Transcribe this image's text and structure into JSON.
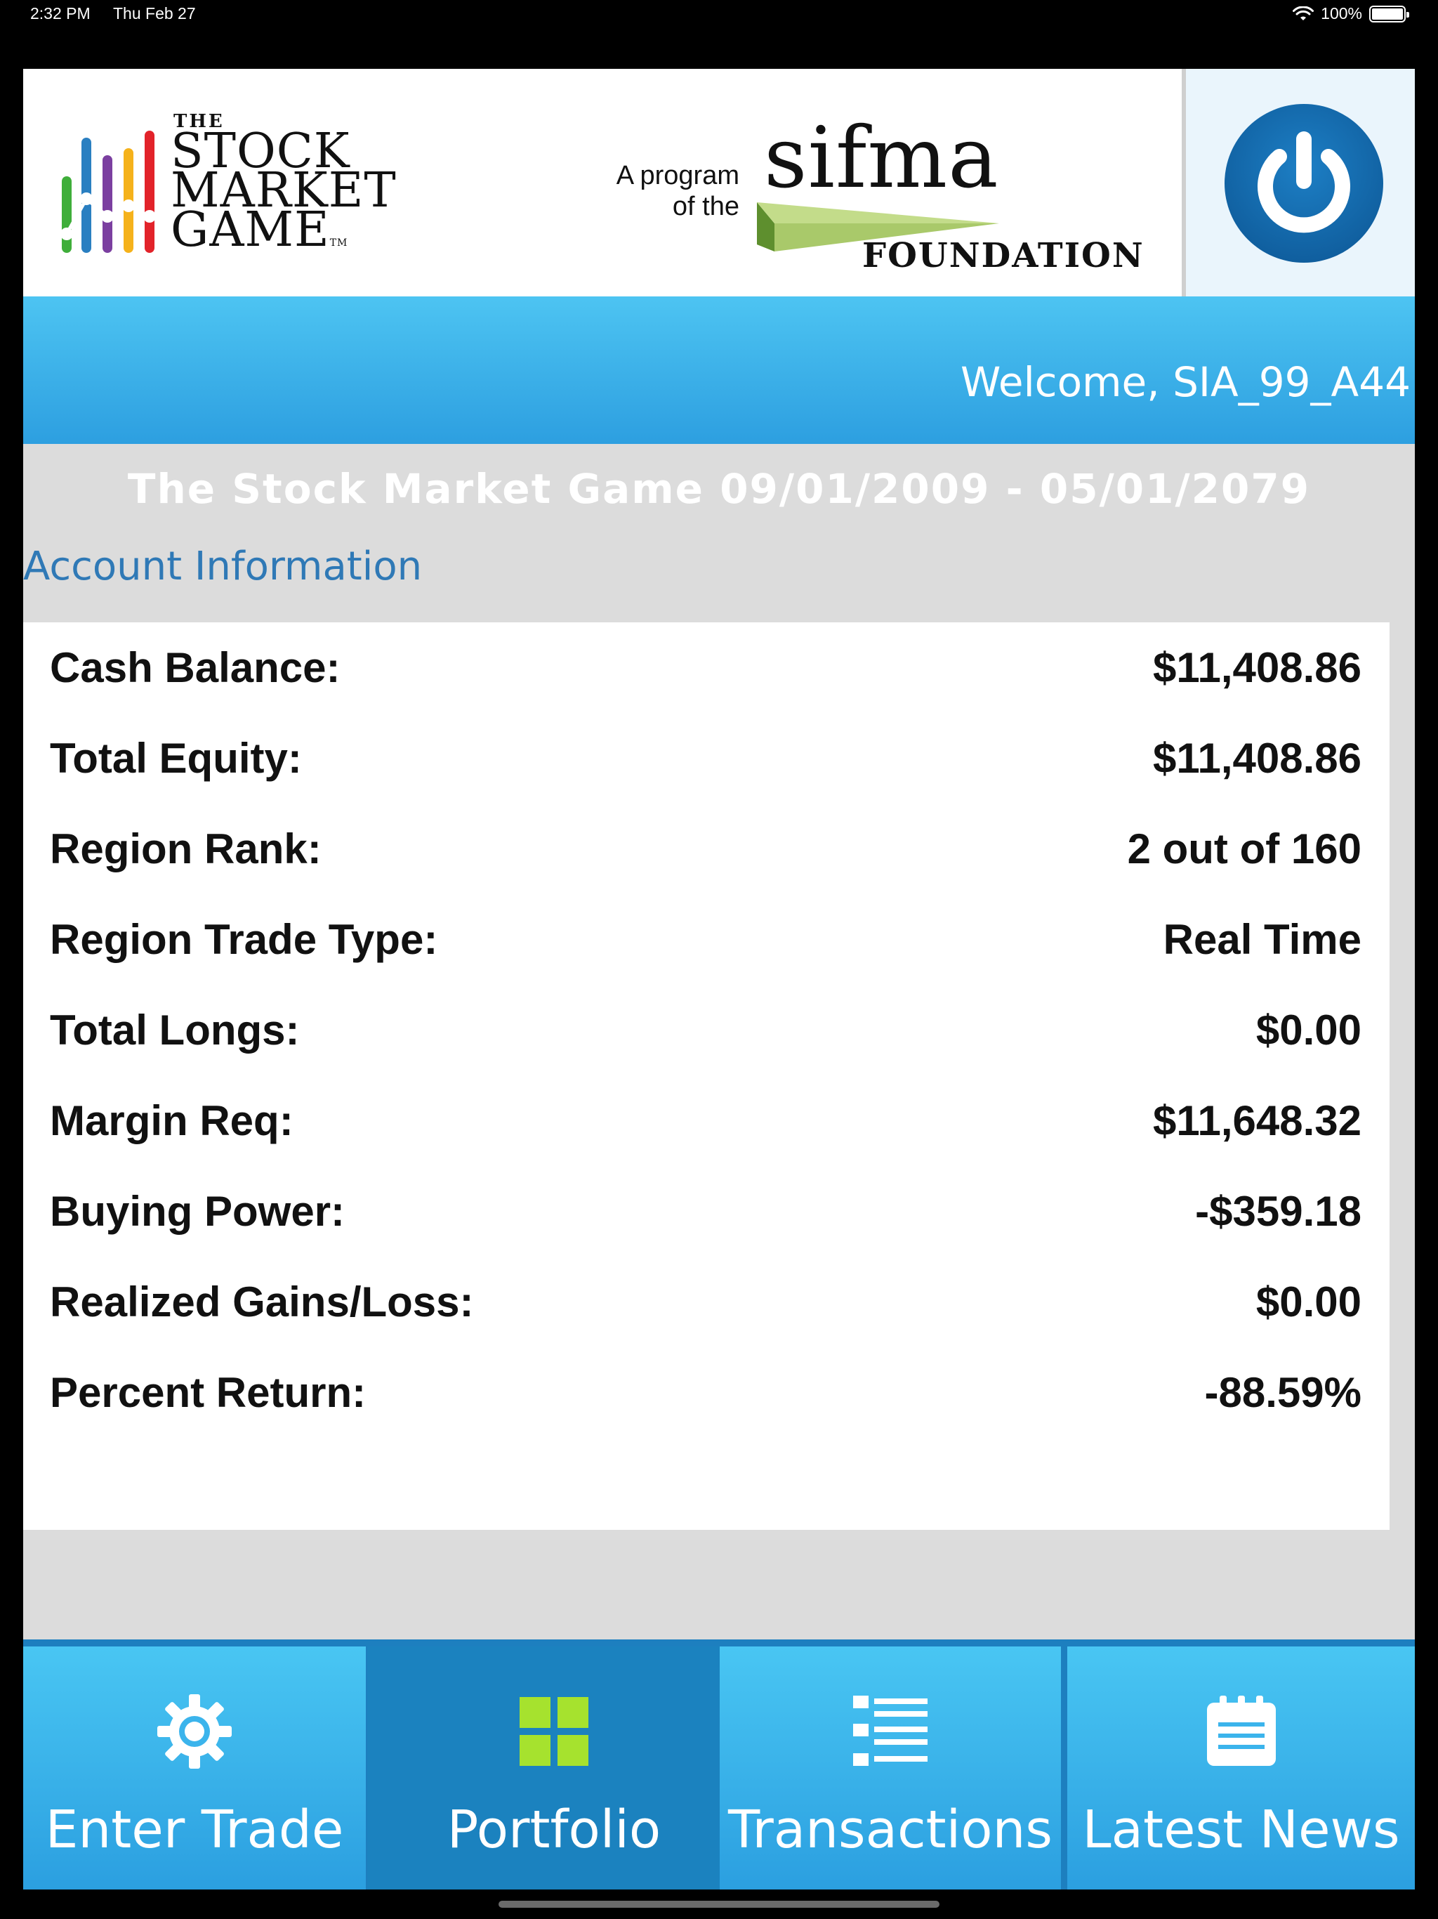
{
  "status_bar": {
    "time": "2:32 PM",
    "date": "Thu Feb 27",
    "battery": "100%"
  },
  "header": {
    "logo": {
      "the": "THE",
      "line1": "STOCK",
      "line2": "MARKET",
      "line3": "GAME",
      "tm": "TM"
    },
    "program_line1": "A program",
    "program_line2": "of the",
    "sifma": "sifma",
    "foundation": "FOUNDATION"
  },
  "welcome": "Welcome, SIA_99_A44",
  "game_title": "The Stock Market Game 09/01/2009 - 05/01/2079",
  "account_heading": "Account Information",
  "account_rows": [
    {
      "label": "Cash Balance:",
      "value": "$11,408.86"
    },
    {
      "label": "Total Equity:",
      "value": "$11,408.86"
    },
    {
      "label": "Region Rank:",
      "value": "2 out of 160"
    },
    {
      "label": "Region Trade Type:",
      "value": "Real Time"
    },
    {
      "label": "Total Longs:",
      "value": "$0.00"
    },
    {
      "label": "Margin Req:",
      "value": "$11,648.32"
    },
    {
      "label": "Buying Power:",
      "value": "-$359.18"
    },
    {
      "label": "Realized Gains/Loss:",
      "value": "$0.00"
    },
    {
      "label": "Percent Return:",
      "value": "-88.59%"
    }
  ],
  "tabs": [
    {
      "label": "Enter Trade",
      "icon": "gear-icon"
    },
    {
      "label": "Portfolio",
      "icon": "grid-icon",
      "active": true
    },
    {
      "label": "Transactions",
      "icon": "list-icon"
    },
    {
      "label": "Latest News",
      "icon": "calendar-icon"
    }
  ],
  "colors": {
    "accent_blue": "#2f79b6",
    "tab_blue": "#2b9fe0",
    "tab_active": "#1b82bf",
    "portfolio_icon": "#a6e22e",
    "power_blue": "#105f9f"
  }
}
